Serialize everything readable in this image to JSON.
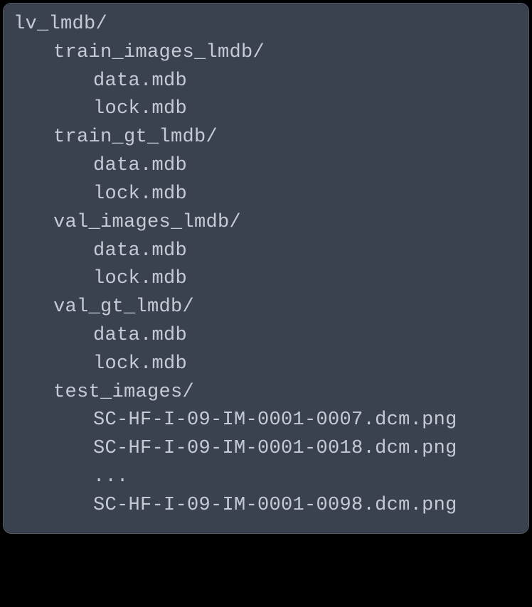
{
  "tree": {
    "root": "lv_lmdb/",
    "children": [
      {
        "name": "train_images_lmdb/",
        "files": [
          "data.mdb",
          "lock.mdb"
        ]
      },
      {
        "name": "train_gt_lmdb/",
        "files": [
          "data.mdb",
          "lock.mdb"
        ]
      },
      {
        "name": "val_images_lmdb/",
        "files": [
          "data.mdb",
          "lock.mdb"
        ]
      },
      {
        "name": "val_gt_lmdb/",
        "files": [
          "data.mdb",
          "lock.mdb"
        ]
      },
      {
        "name": "test_images/",
        "files": [
          "SC-HF-I-09-IM-0001-0007.dcm.png",
          "SC-HF-I-09-IM-0001-0018.dcm.png",
          "...",
          "SC-HF-I-09-IM-0001-0098.dcm.png"
        ]
      }
    ]
  }
}
